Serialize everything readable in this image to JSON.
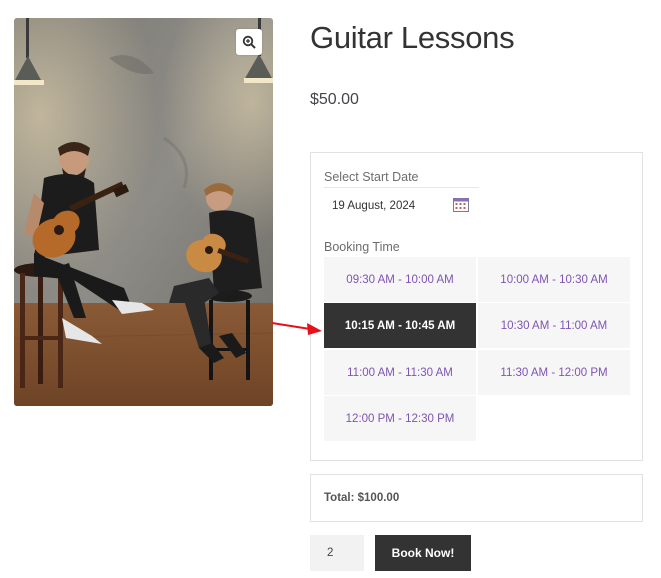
{
  "product": {
    "title": "Guitar Lessons",
    "price": "$50.00",
    "image_icon": "zoom-in-icon"
  },
  "booking": {
    "date_label": "Select Start Date",
    "date_value": "19 August, 2024",
    "date_icon": "calendar-icon",
    "time_label": "Booking Time",
    "slots": [
      {
        "label": "09:30 AM - 10:00 AM",
        "selected": false
      },
      {
        "label": "10:00 AM - 10:30 AM",
        "selected": false
      },
      {
        "label": "10:15 AM - 10:45 AM",
        "selected": true
      },
      {
        "label": "10:30 AM - 11:00 AM",
        "selected": false
      },
      {
        "label": "11:00 AM - 11:30 AM",
        "selected": false
      },
      {
        "label": "11:30 AM - 12:00 PM",
        "selected": false
      },
      {
        "label": "12:00 PM - 12:30 PM",
        "selected": false
      }
    ]
  },
  "total": {
    "text": "Total: $100.00"
  },
  "cart": {
    "quantity": "2",
    "book_label": "Book Now!"
  },
  "colors": {
    "accent": "#7f54b3",
    "selected_bg": "#333333",
    "slot_bg": "#f6f6f6",
    "annotation_arrow": "#e8101a"
  }
}
